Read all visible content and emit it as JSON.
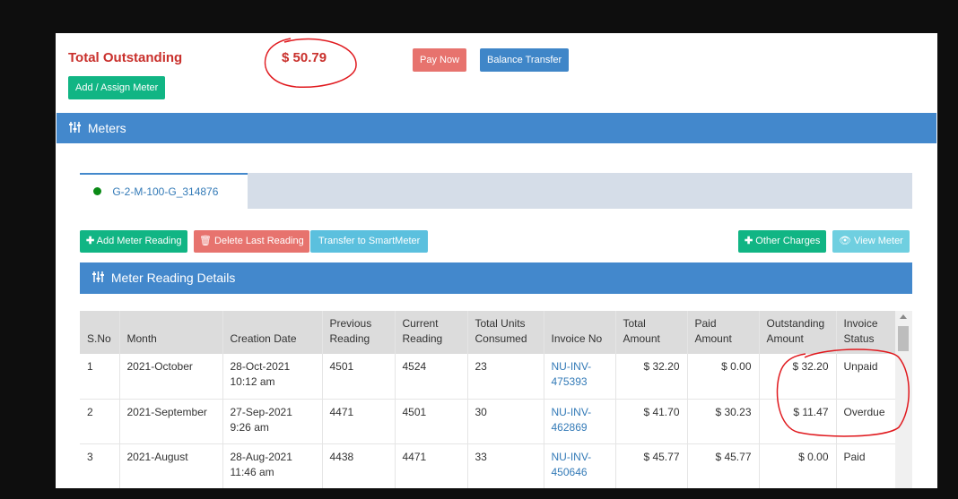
{
  "summary": {
    "total_label": "Total Outstanding",
    "total_amount": "$ 50.79"
  },
  "buttons": {
    "pay_now": "Pay Now",
    "balance_transfer": "Balance Transfer",
    "add_assign_meter": "Add / Assign Meter",
    "add_meter_reading": "Add Meter Reading",
    "delete_last_reading": "Delete Last Reading",
    "transfer_smartmeter": "Transfer to SmartMeter",
    "other_charges": "Other Charges",
    "view_meter": "View Meter"
  },
  "meters_section": {
    "title": "Meters"
  },
  "tabs": [
    {
      "label": "G-2-M-100-G_314876",
      "status_color": "#0a8a16",
      "active": true
    }
  ],
  "details_section": {
    "title": "Meter Reading Details"
  },
  "table": {
    "headers": [
      "S.No",
      "Month",
      "Creation Date",
      "Previous Reading",
      "Current Reading",
      "Total Units Consumed",
      "Invoice No",
      "Total Amount",
      "Paid Amount",
      "Outstanding Amount",
      "Invoice Status"
    ],
    "rows": [
      {
        "sno": "1",
        "month": "2021-October",
        "date": "28-Oct-2021",
        "time": "10:12 am",
        "prev": "4501",
        "curr": "4524",
        "units": "23",
        "invoice_a": "NU-INV-",
        "invoice_b": "475393",
        "total": "$ 32.20",
        "paid": "$ 0.00",
        "outstanding": "$ 32.20",
        "status": "Unpaid"
      },
      {
        "sno": "2",
        "month": "2021-September",
        "date": "27-Sep-2021",
        "time": "9:26 am",
        "prev": "4471",
        "curr": "4501",
        "units": "30",
        "invoice_a": "NU-INV-",
        "invoice_b": "462869",
        "total": "$ 41.70",
        "paid": "$ 30.23",
        "outstanding": "$ 11.47",
        "status": "Overdue"
      },
      {
        "sno": "3",
        "month": "2021-August",
        "date": "28-Aug-2021",
        "time": "11:46 am",
        "prev": "4438",
        "curr": "4471",
        "units": "33",
        "invoice_a": "NU-INV-",
        "invoice_b": "450646",
        "total": "$ 45.77",
        "paid": "$ 45.77",
        "outstanding": "$ 0.00",
        "status": "Paid"
      }
    ]
  },
  "icons": {
    "sliders": "sliders-icon",
    "plus": "plus-icon",
    "trash": "trash-icon",
    "eye": "eye-icon"
  },
  "colors": {
    "danger": "#c9302c",
    "primary_bar": "#4388cc",
    "success": "#11b584",
    "annotation": "#e0191e"
  }
}
